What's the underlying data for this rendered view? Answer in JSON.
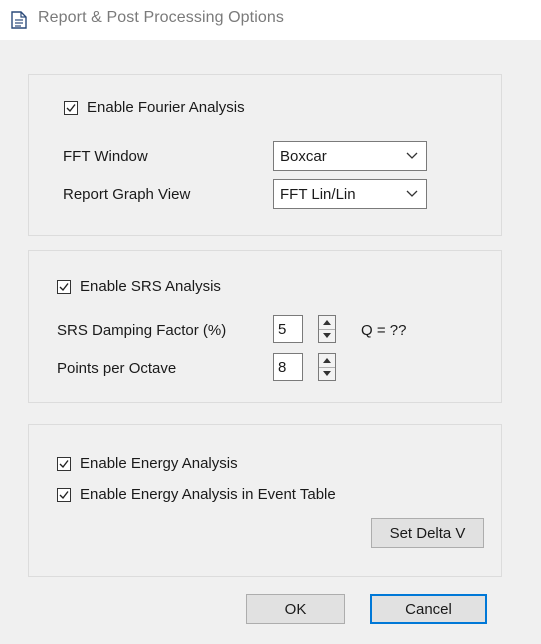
{
  "window": {
    "title": "Report & Post Processing Options",
    "icon": "document-icon"
  },
  "fourier": {
    "enable_label": "Enable Fourier Analysis",
    "enabled": true,
    "fft_window_label": "FFT Window",
    "fft_window_value": "Boxcar",
    "graph_view_label": "Report Graph View",
    "graph_view_value": "FFT Lin/Lin"
  },
  "srs": {
    "enable_label": "Enable SRS Analysis",
    "enabled": true,
    "damping_label": "SRS Damping Factor (%)",
    "damping_value": "5",
    "q_label": "Q = ??",
    "points_label": "Points per Octave",
    "points_value": "8"
  },
  "energy": {
    "enable_label": "Enable Energy Analysis",
    "enabled": true,
    "event_table_label": "Enable Energy Analysis in Event Table",
    "event_table_enabled": true,
    "delta_v_button": "Set Delta V"
  },
  "buttons": {
    "ok": "OK",
    "cancel": "Cancel"
  },
  "colors": {
    "default_button_border": "#0078d7",
    "dialog_bg": "#f0f0f0"
  }
}
